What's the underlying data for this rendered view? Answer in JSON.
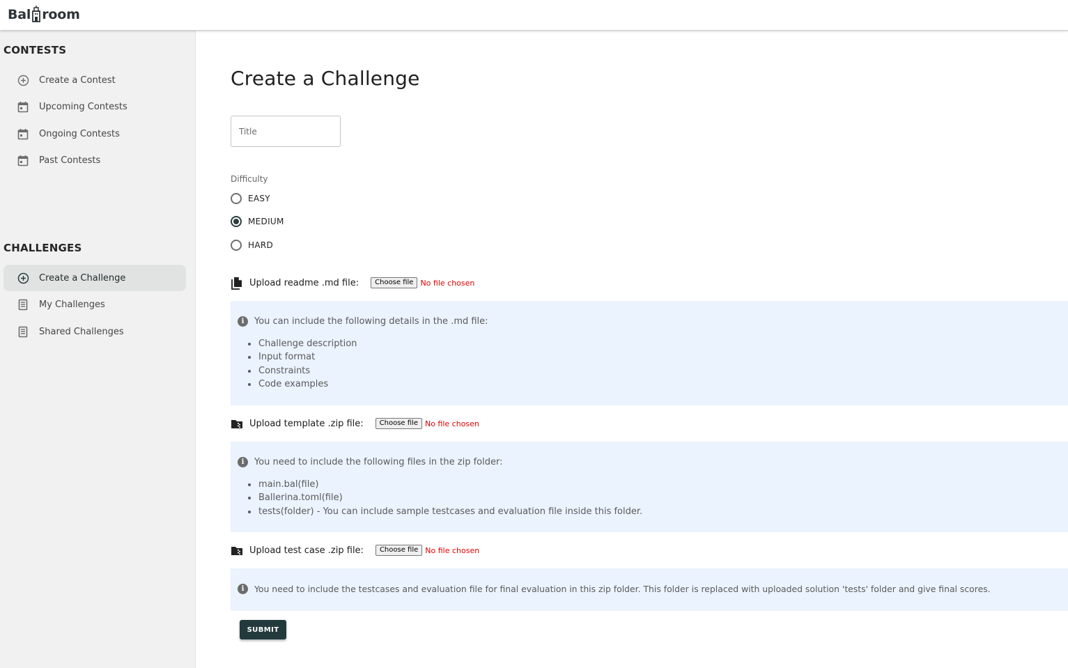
{
  "app": {
    "logo_text_left": "Bal",
    "logo_text_right": "room"
  },
  "sidebar": {
    "contests_title": "CONTESTS",
    "contests": [
      {
        "label": "Create a Contest",
        "icon": "add-circle-icon"
      },
      {
        "label": "Upcoming Contests",
        "icon": "calendar-icon"
      },
      {
        "label": "Ongoing Contests",
        "icon": "calendar-icon"
      },
      {
        "label": "Past Contests",
        "icon": "calendar-icon"
      }
    ],
    "challenges_title": "CHALLENGES",
    "challenges": [
      {
        "label": "Create a Challenge",
        "icon": "add-circle-icon",
        "active": true
      },
      {
        "label": "My Challenges",
        "icon": "document-list-icon"
      },
      {
        "label": "Shared Challenges",
        "icon": "document-list-icon"
      }
    ]
  },
  "form": {
    "page_title": "Create a Challenge",
    "title_placeholder": "Title",
    "difficulty_label": "Difficulty",
    "difficulty_options": [
      "EASY",
      "MEDIUM",
      "HARD"
    ],
    "difficulty_selected": "MEDIUM",
    "readme": {
      "label": "Upload readme .md file:",
      "button": "Choose file",
      "status": "No file chosen",
      "info": "You can include the following details in the .md file:",
      "items": [
        "Challenge description",
        "Input format",
        "Constraints",
        "Code examples"
      ]
    },
    "template": {
      "label": "Upload template .zip file:",
      "button": "Choose file",
      "status": "No file chosen",
      "info": "You need to include the following files in the zip folder:",
      "items": [
        "main.bal(file)",
        "Ballerina.toml(file)",
        "tests(folder) - You can include sample testcases and evaluation file inside this folder."
      ]
    },
    "testcase": {
      "label": "Upload test case .zip file:",
      "button": "Choose file",
      "status": "No file chosen",
      "info": "You need to include the testcases and evaluation file for final evaluation in this zip folder. This folder is replaced with uploaded solution 'tests' folder and give final scores."
    },
    "submit_label": "SUBMIT"
  },
  "colors": {
    "accent": "#233a3d",
    "info_bg": "#ebf3fe",
    "sidebar_bg": "#f1f1f1",
    "error": "#e00000"
  }
}
